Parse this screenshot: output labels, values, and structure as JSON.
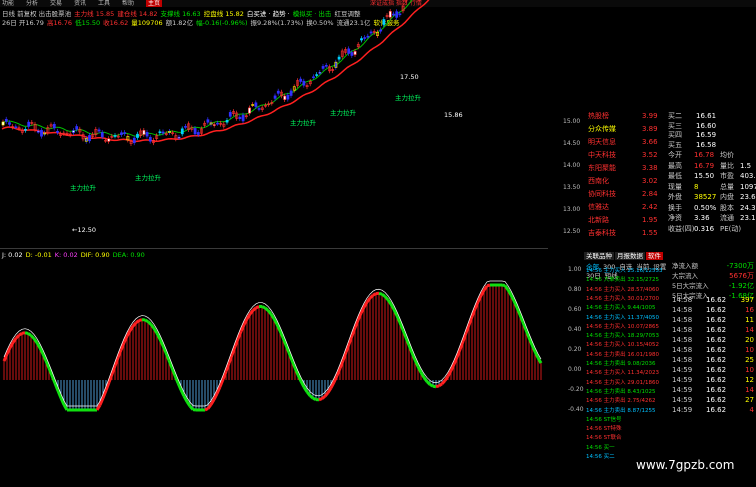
{
  "menu": [
    "功能",
    "分析",
    "交易",
    "资讯",
    "工具",
    "帮助",
    "主页"
  ],
  "menu_active": "主页",
  "top_right_note": "深证成指 指数 行情",
  "header_line1": [
    {
      "t": "日线 前复权 出击股票池",
      "c": "#ccc"
    },
    {
      "t": "主力线 15.85",
      "c": "#ff3030"
    },
    {
      "t": "建仓线 14.82",
      "c": "#ff3030"
    },
    {
      "t": "支撑线 16.63",
      "c": "#00e000"
    },
    {
      "t": "控盘线 15.82",
      "c": "#ffff00"
    },
    {
      "t": "白买进 · 趋势 ·",
      "c": "#fff"
    },
    {
      "t": "模拟买 · 出击",
      "c": "#00e000"
    },
    {
      "t": "红豆调整",
      "c": "#ccc"
    }
  ],
  "header_line2": [
    {
      "t": "26日 开16.79",
      "c": "#ccc"
    },
    {
      "t": "高16.76",
      "c": "#ff3030"
    },
    {
      "t": "低15.50",
      "c": "#00e000"
    },
    {
      "t": "收16.62",
      "c": "#ff3030"
    },
    {
      "t": "量109706",
      "c": "#ffff00"
    },
    {
      "t": "额1.82亿",
      "c": "#ccc"
    },
    {
      "t": "幅-0.16(-0.96%)",
      "c": "#00e000"
    },
    {
      "t": "振9.28%(1.73%)",
      "c": "#ccc"
    },
    {
      "t": "换0.50%",
      "c": "#ccc"
    },
    {
      "t": "流通23.1亿",
      "c": "#ccc"
    },
    {
      "t": "软件服务",
      "c": "#ffff00"
    }
  ],
  "kline_annotations": [
    "主力拉升",
    "主力拉升",
    "主力拉升",
    "主力拉升",
    "主力拉升"
  ],
  "kline_low_label": "←12.50",
  "kline_high_label": "17.50",
  "kline_right_label": "15.86",
  "indicator_header": [
    {
      "t": "J: 0.02",
      "c": "#fff"
    },
    {
      "t": "D: -0.01",
      "c": "#ffff00"
    },
    {
      "t": "K: 0.02",
      "c": "#ff40ff"
    },
    {
      "t": "DIF: 0.90",
      "c": "#ffff00"
    },
    {
      "t": "DEA: 0.90",
      "c": "#00e000"
    }
  ],
  "right_panel": {
    "price_axis": [
      "15.00",
      "14.50",
      "14.00",
      "13.50",
      "13.00",
      "12.50"
    ],
    "blocks": [
      {
        "n": "热股榜",
        "v": "3.99",
        "c": "#ff3030"
      },
      {
        "n": "分众传媒",
        "v": "3.89",
        "c": "#ff3030"
      },
      {
        "n": "明天信息",
        "v": "3.66",
        "c": "#ff3030"
      },
      {
        "n": "中天科技",
        "v": "3.52",
        "c": "#ff3030"
      },
      {
        "n": "东阳聚能",
        "v": "3.38",
        "c": "#ff3030"
      },
      {
        "n": "西南化",
        "v": "3.02",
        "c": "#ff3030"
      },
      {
        "n": "协同科技",
        "v": "2.84",
        "c": "#ff3030"
      },
      {
        "n": "信雅达",
        "v": "2.42",
        "c": "#ff3030"
      },
      {
        "n": "北新路",
        "v": "1.95",
        "c": "#ff3030"
      },
      {
        "n": "吉泰科技",
        "v": "1.55",
        "c": "#ff3030"
      }
    ],
    "bid_ask": [
      {
        "l": "买二",
        "p": "16.61"
      },
      {
        "l": "买三",
        "p": "16.60"
      },
      {
        "l": "买四",
        "p": "16.59"
      },
      {
        "l": "买五",
        "p": "16.58"
      }
    ],
    "stats": [
      {
        "l": "今开",
        "v": "16.78",
        "l2": "均价",
        "v2": ""
      },
      {
        "l": "最高",
        "v": "16.79",
        "l2": "量比",
        "v2": "1.5"
      },
      {
        "l": "最低",
        "v": "15.50",
        "l2": "市盈",
        "v2": "403.7"
      },
      {
        "l": "现量",
        "v": "8",
        "l2": "总量",
        "v2": "1097"
      },
      {
        "l": "外盘",
        "v": "38527",
        "l2": "内盘",
        "v2": "23.6"
      },
      {
        "l": "换手",
        "v": "0.50%",
        "l2": "股本",
        "v2": "24.3"
      },
      {
        "l": "净资",
        "v": "3.36",
        "l2": "流通",
        "v2": "23.1"
      },
      {
        "l": "收益(四)",
        "v": "0.316",
        "l2": "PE(动)",
        "v2": ""
      }
    ],
    "tabs": [
      "关联品种",
      "月报数据",
      "软件"
    ],
    "tabs2": [
      "全部",
      "300",
      "自选",
      "当前",
      "设置",
      "30日",
      "短线"
    ],
    "flow_items": [
      {
        "l": "净流入额",
        "v": "-7300万"
      },
      {
        "l": "大宗流入",
        "v": "5676万"
      },
      {
        "l": "5日大宗流入",
        "v": "-1.92亿"
      },
      {
        "l": "5日大宗流入",
        "v": "-1.68亿"
      }
    ],
    "flow_axis": [
      "1.00",
      "0.80",
      "0.60",
      "0.40",
      "0.20",
      "0.00",
      "-0.20",
      "-0.40"
    ],
    "news": [
      "14:56 主力买入 25.16/12553",
      "14:56 大单卖出 32.15/2725",
      "14:56 主力买入 28.57/4060",
      "14:56 主力买入 30.01/2700",
      "14:56 主力买入 9.44/1005",
      "14:56 主力买入 11.37/4050",
      "14:56 主力买入 10.07/2865",
      "14:56 主力买入 18.29/7053",
      "14:56 主力买入 10.15/4052",
      "14:56 主力卖出 16.01/1980",
      "14:56 主力卖出 9.08/2036",
      "14:56 主力买入 11.34/2023",
      "14:56 主力买入 29.01/1860",
      "14:56 主力卖出 8.43/1025",
      "14:56 主力卖出 2.75/4262",
      "14:56 主力卖出 8.87/1255",
      "14:56 ST信号 ",
      "14:56 ST特殊",
      "14:56 ST联合",
      "14:56 买一",
      "14:56 买二"
    ],
    "trades": [
      {
        "t": "14:58",
        "p": "16.62",
        "v": "397"
      },
      {
        "t": "14:58",
        "p": "16.62",
        "v": "16"
      },
      {
        "t": "14:58",
        "p": "16.62",
        "v": "11"
      },
      {
        "t": "14:58",
        "p": "16.62",
        "v": "14"
      },
      {
        "t": "14:58",
        "p": "16.62",
        "v": "20"
      },
      {
        "t": "14:58",
        "p": "16.62",
        "v": "10"
      },
      {
        "t": "14:58",
        "p": "16.62",
        "v": "25"
      },
      {
        "t": "14:59",
        "p": "16.62",
        "v": "10"
      },
      {
        "t": "14:59",
        "p": "16.62",
        "v": "12"
      },
      {
        "t": "14:59",
        "p": "16.62",
        "v": "14"
      },
      {
        "t": "14:59",
        "p": "16.62",
        "v": "27"
      },
      {
        "t": "14:59",
        "p": "16.62",
        "v": "4"
      }
    ]
  },
  "watermark": "www.7gpzb.com"
}
